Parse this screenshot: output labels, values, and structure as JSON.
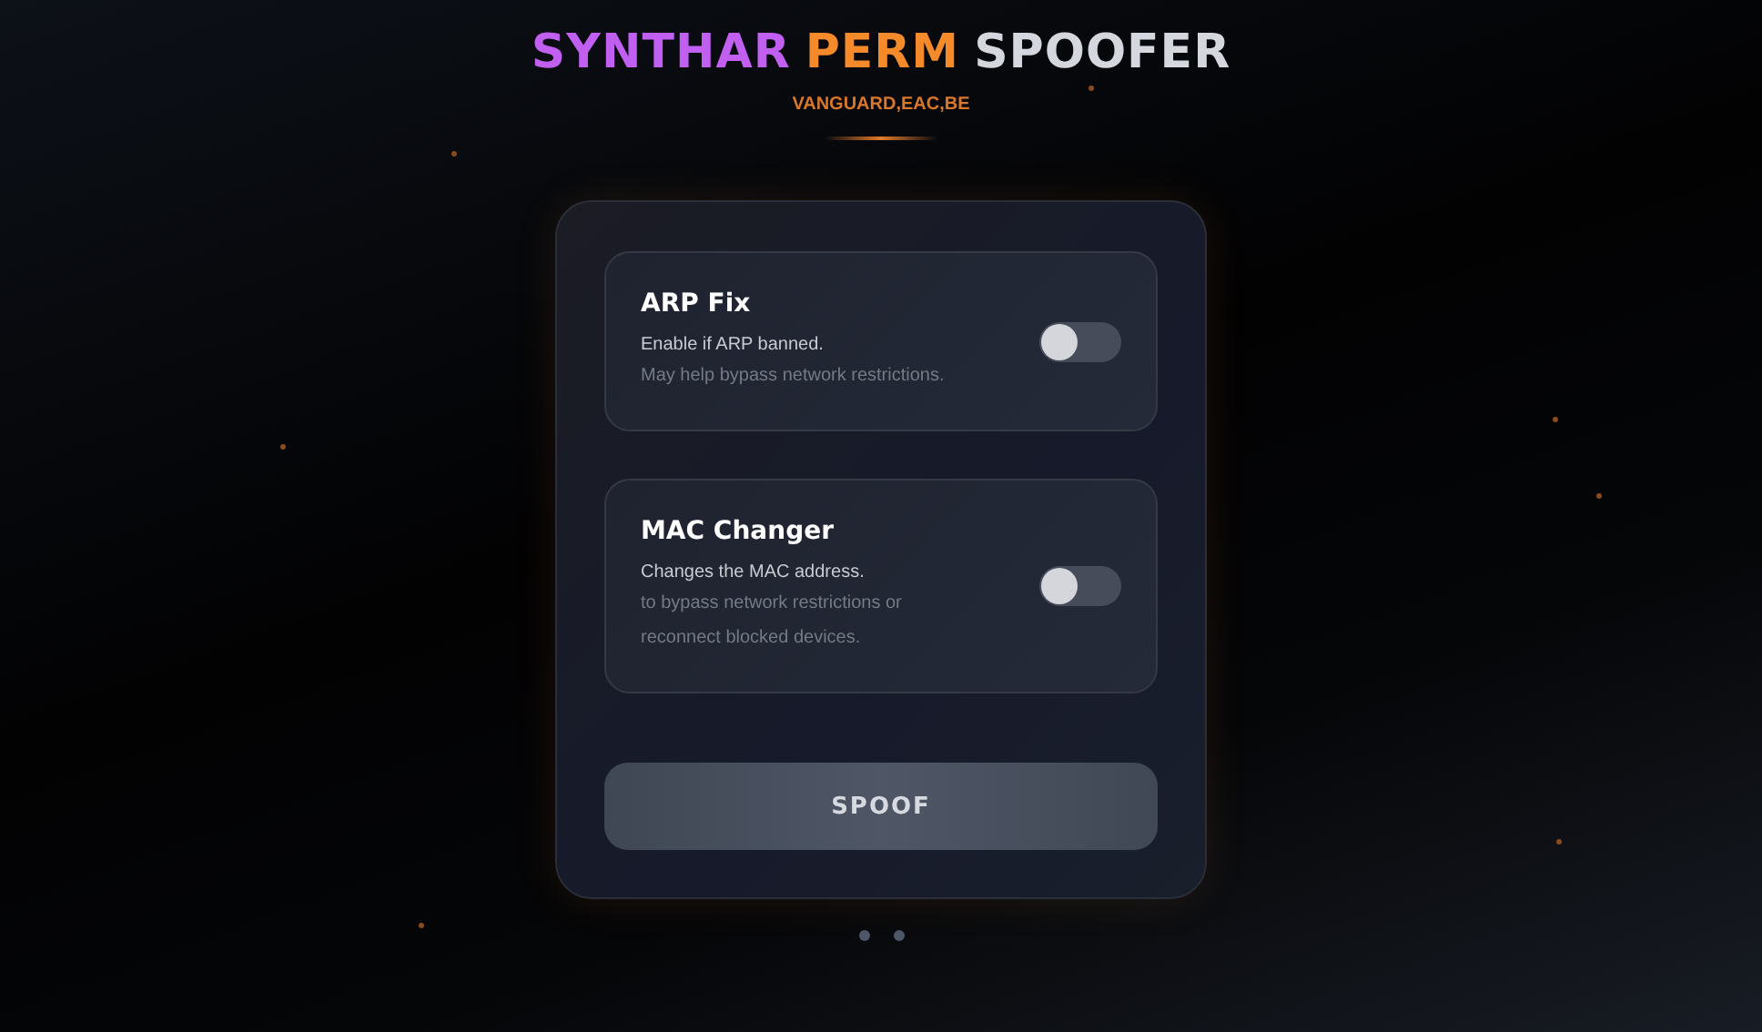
{
  "title": [
    {
      "text": "SYNTHAR",
      "color": "#c05ff0"
    },
    {
      "text": "PERM",
      "color": "#f58a2a"
    },
    {
      "text": "SPOOFER",
      "color": "#d4d8de"
    }
  ],
  "subtitle": "VANGUARD,EAC,BE",
  "options": [
    {
      "title": "ARP Fix",
      "description": "Enable if ARP banned.",
      "details": [
        "May help bypass network restrictions."
      ],
      "on": false
    },
    {
      "title": "MAC Changer",
      "description": "Changes the MAC address.",
      "details": [
        "to bypass network restrictions or",
        "reconnect blocked devices."
      ],
      "on": false
    }
  ],
  "button": "SPOOF"
}
